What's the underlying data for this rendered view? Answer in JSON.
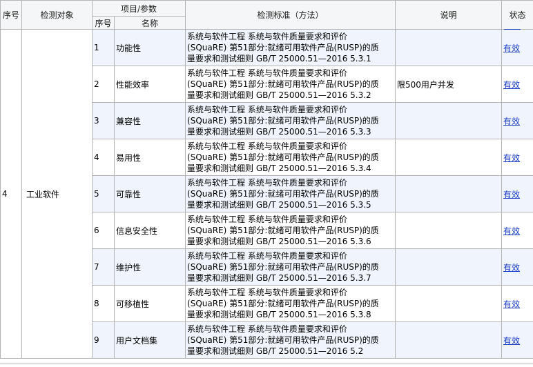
{
  "header": {
    "seq": "序号",
    "object": "检测对象",
    "item_group": "项目/参数",
    "item_seq": "序号",
    "item_name": "名称",
    "standard": "检测标准（方法）",
    "note": "说明",
    "status": "状态"
  },
  "group": {
    "seq": "4",
    "object": "工业软件"
  },
  "rows": [
    {
      "seq": "1",
      "name": "功能性",
      "std1": "系统与软件工程 系统与软件质量要求和评价",
      "std2": "(SQuaRE) 第51部分:就绪可用软件产品(RUSP)的质",
      "std3": "量要求和测试细则 GB/T 25000.51—2016 5.3.1",
      "note": "",
      "status": "有效"
    },
    {
      "seq": "2",
      "name": "性能效率",
      "std1": "系统与软件工程 系统与软件质量要求和评价",
      "std2": "(SQuaRE) 第51部分:就绪可用软件产品(RUSP)的质",
      "std3": "量要求和测试细则 GB/T 25000.51—2016 5.3.2",
      "note": "限500用户并发",
      "status": "有效"
    },
    {
      "seq": "3",
      "name": "兼容性",
      "std1": "系统与软件工程 系统与软件质量要求和评价",
      "std2": "(SQuaRE) 第51部分:就绪可用软件产品(RUSP)的质",
      "std3": "量要求和测试细则 GB/T 25000.51—2016 5.3.3",
      "note": "",
      "status": "有效"
    },
    {
      "seq": "4",
      "name": "易用性",
      "std1": "系统与软件工程 系统与软件质量要求和评价",
      "std2": "(SQuaRE) 第51部分:就绪可用软件产品(RUSP)的质",
      "std3": "量要求和测试细则 GB/T 25000.51—2016 5.3.4",
      "note": "",
      "status": "有效"
    },
    {
      "seq": "5",
      "name": "可靠性",
      "std1": "系统与软件工程 系统与软件质量要求和评价",
      "std2": "(SQuaRE) 第51部分:就绪可用软件产品(RUSP)的质",
      "std3": "量要求和测试细则 GB/T 25000.51—2016 5.3.5",
      "note": "",
      "status": "有效"
    },
    {
      "seq": "6",
      "name": "信息安全性",
      "std1": "系统与软件工程 系统与软件质量要求和评价",
      "std2": "(SQuaRE) 第51部分:就绪可用软件产品(RUSP)的质",
      "std3": "量要求和测试细则 GB/T 25000.51—2016 5.3.6",
      "note": "",
      "status": "有效"
    },
    {
      "seq": "7",
      "name": "维护性",
      "std1": "系统与软件工程 系统与软件质量要求和评价",
      "std2": "(SQuaRE) 第51部分:就绪可用软件产品(RUSP)的质",
      "std3": "量要求和测试细则 GB/T 25000.51—2016 5.3.7",
      "note": "",
      "status": "有效"
    },
    {
      "seq": "8",
      "name": "可移植性",
      "std1": "系统与软件工程 系统与软件质量要求和评价",
      "std2": "(SQuaRE) 第51部分:就绪可用软件产品(RUSP)的质",
      "std3": "量要求和测试细则 GB/T 25000.51—2016 5.3.8",
      "note": "",
      "status": "有效"
    },
    {
      "seq": "9",
      "name": "用户文档集",
      "std1": "系统与软件工程 系统与软件质量要求和评价",
      "std2": "(SQuaRE) 第51部分:就绪可用软件产品(RUSP)的质",
      "std3": "量要求和测试细则 GB/T 25000.51—2016 5.2",
      "note": "",
      "status": "有效"
    }
  ]
}
